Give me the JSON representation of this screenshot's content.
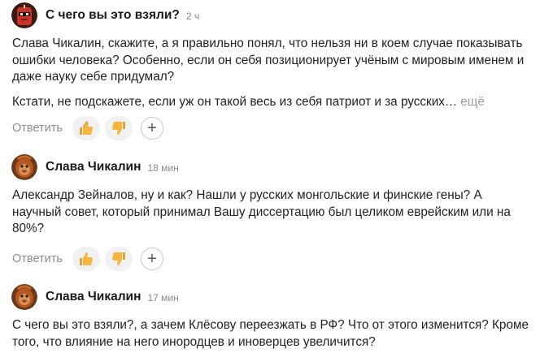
{
  "comments": [
    {
      "author": "С чего вы это взяли?",
      "time": "2 ч",
      "paragraphs": [
        "Слава Чикалин, скажите, а я правильно понял, что нельзя ни в коем случае показывать ошибки человека? Особенно, если он себя позиционирует учёным с мировым именем и даже науку себе придумал?",
        "Кстати, не подскажете, если уж он такой весь из себя патриот и за русских…"
      ],
      "more_label": "ещё",
      "reply_label": "Ответить",
      "avatar_icon": "red-robot-avatar"
    },
    {
      "author": "Слава Чикалин",
      "time": "18 мин",
      "paragraphs": [
        "Александр Зейналов, ну и как? Нашли у русских монгольские и финские гены? А научный совет, который принимал Вашу диссертацию был целиком еврейским или на 80%?"
      ],
      "reply_label": "Ответить",
      "avatar_icon": "orangutan-avatar"
    },
    {
      "author": "Слава Чикалин",
      "time": "17 мин",
      "paragraphs": [
        "С чего вы это взяли?, а зачем Клёсову переезжать в РФ? Что от этого изменится? Кроме того, что влияние на него инородцев и иноверцев увеличится?"
      ],
      "avatar_icon": "orangutan-avatar"
    }
  ],
  "icons": {
    "like": "thumbs-up-icon",
    "dislike": "thumbs-down-icon",
    "add": "plus-icon"
  },
  "colors": {
    "reaction_bg": "#f1f1f1",
    "secondary_text": "#8c8c8c"
  }
}
